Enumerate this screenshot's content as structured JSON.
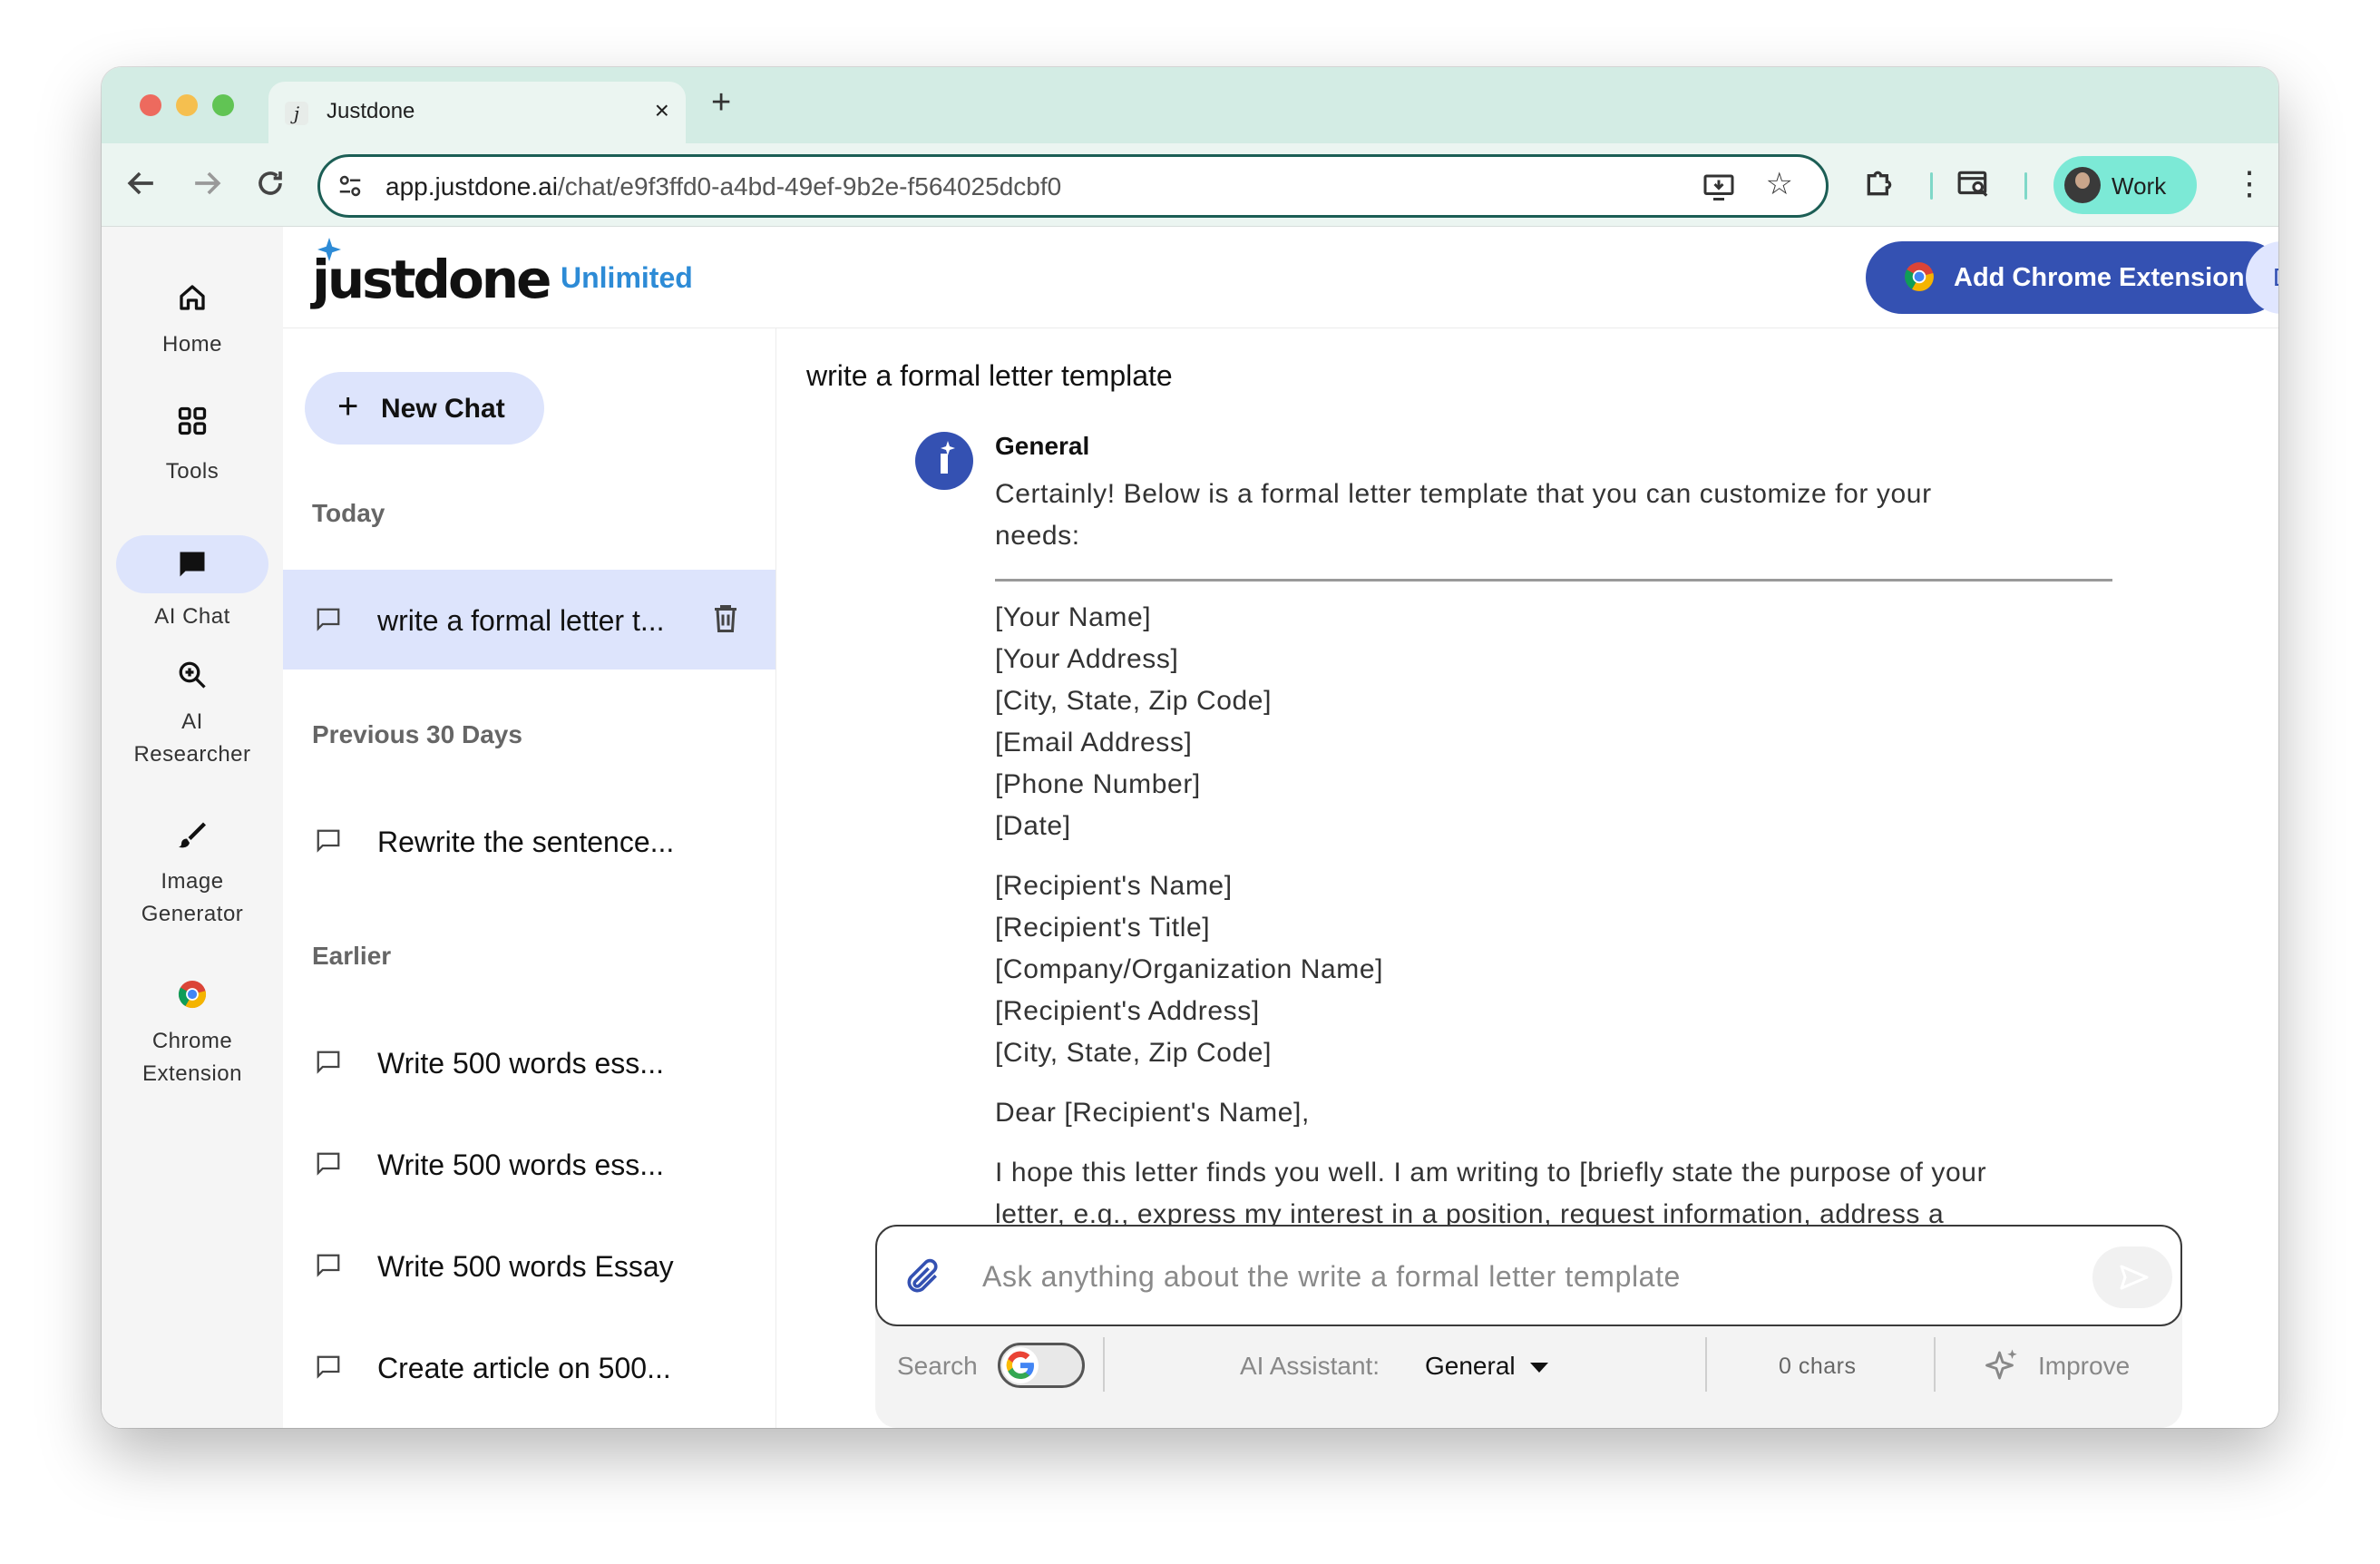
{
  "browser": {
    "tab_title": "Justdone",
    "tab_favicon": "j",
    "new_tab": "+",
    "close_tab": "×",
    "url_host": "app.justdone.ai",
    "url_path": "/chat/e9f3ffd0-a4bd-49ef-9b2e-f564025dcbf0",
    "profile_label": "Work",
    "icons": [
      "back-icon",
      "forward-icon",
      "reload-icon",
      "site-settings-icon",
      "install-icon",
      "star-icon",
      "extensions-icon",
      "cast-icon",
      "menu-icon"
    ]
  },
  "nav": {
    "items": [
      {
        "label": "Home",
        "icon": "home-icon"
      },
      {
        "label": "Tools",
        "icon": "grid-icon"
      },
      {
        "label": "AI Chat",
        "icon": "chat-icon",
        "active": true
      },
      {
        "label_line1": "AI",
        "label_line2": "Researcher",
        "icon": "zoom-plus-icon"
      },
      {
        "label_line1": "Image",
        "label_line2": "Generator",
        "icon": "brush-icon"
      },
      {
        "label_line1": "Chrome",
        "label_line2": "Extension",
        "icon": "chrome-icon"
      }
    ]
  },
  "header": {
    "logo": "justdone",
    "plan": "Unlimited",
    "cta": "Add Chrome Extension",
    "avatar_initial": "D"
  },
  "chatlist": {
    "new_chat": "New Chat",
    "sections": [
      {
        "heading": "Today",
        "chats": [
          {
            "title": "write a formal letter t...",
            "active": true
          }
        ]
      },
      {
        "heading": "Previous 30 Days",
        "chats": [
          {
            "title": "Rewrite the sentence..."
          }
        ]
      },
      {
        "heading": "Earlier",
        "chats": [
          {
            "title": "Write 500 words ess..."
          },
          {
            "title": "Write 500 words ess..."
          },
          {
            "title": "Write 500 words Essay"
          },
          {
            "title": "Create article on 500..."
          }
        ]
      }
    ]
  },
  "conversation": {
    "user_message": "write a formal letter template",
    "assistant_name": "General",
    "intro_line1": "Certainly! Below is a formal letter template that you can customize for your",
    "intro_line2": "needs:",
    "sender_block": [
      "[Your Name]",
      "[Your Address]",
      "[City, State, Zip Code]",
      "[Email Address]",
      "[Phone Number]",
      "[Date]"
    ],
    "recipient_block": [
      "[Recipient's Name]",
      "[Recipient's Title]",
      "[Company/Organization Name]",
      "[Recipient's Address]",
      "[City, State, Zip Code]"
    ],
    "salutation": "Dear [Recipient's Name],",
    "body_line1": "I hope this letter finds you well. I am writing to [briefly state the purpose of your",
    "body_line2": "letter, e.g., express my interest in a position, request information, address a"
  },
  "composer": {
    "placeholder": "Ask anything about the write a formal letter template",
    "search_label": "Search",
    "assistant_label": "AI Assistant:",
    "assistant_value": "General",
    "chars": "0 chars",
    "improve": "Improve"
  },
  "colors": {
    "accent": "#3451b2",
    "active_bg": "#dde4fc",
    "plan_text": "#2d8bd6",
    "titlebar": "#d3ece4",
    "profile_chip": "#7ce9d6"
  }
}
